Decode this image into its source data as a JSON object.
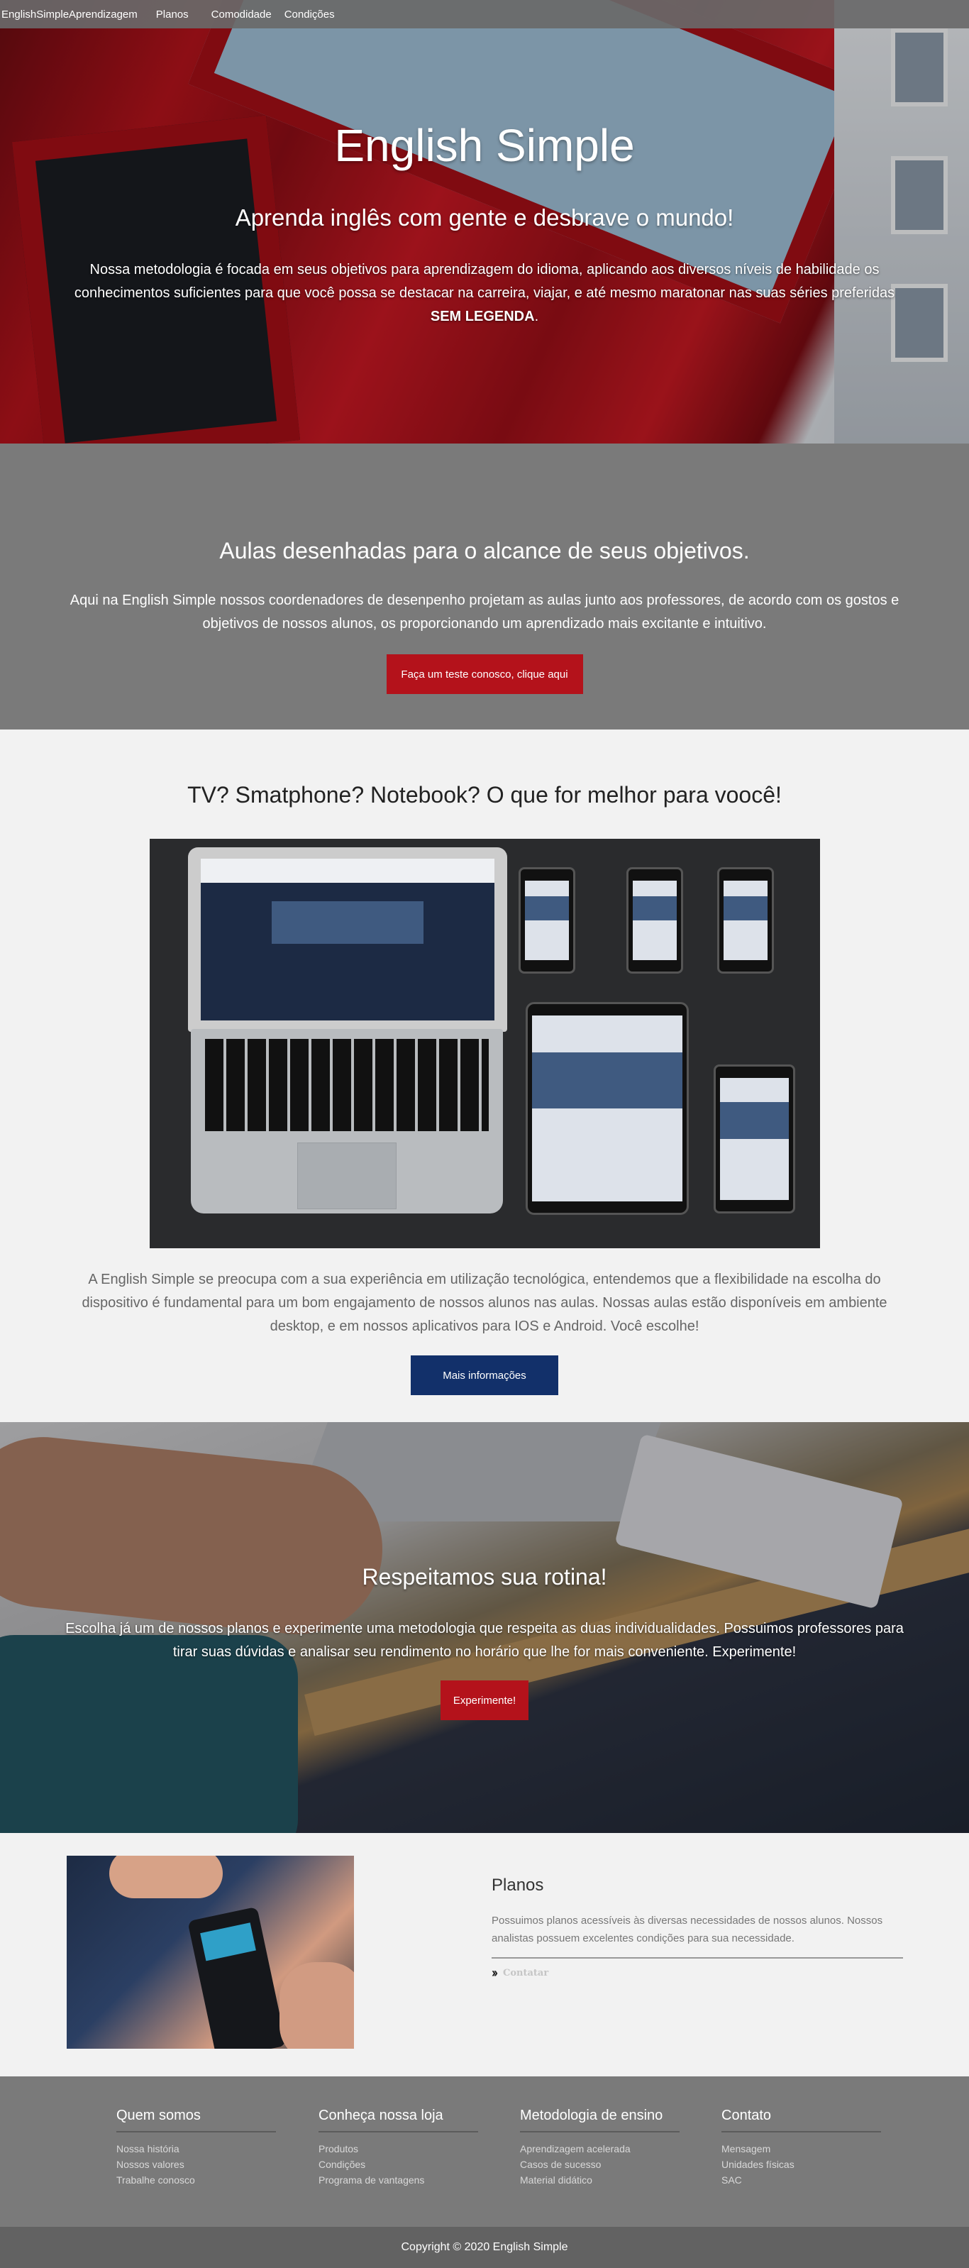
{
  "nav": {
    "brand": "EnglishSimple",
    "links": [
      "Aprendizagem",
      "Planos",
      "Comodidade",
      "Condições"
    ]
  },
  "hero": {
    "title": "English Simple",
    "subtitle": "Aprenda inglês com gente e desbrave o mundo!",
    "text": "Nossa metodologia é focada em seus objetivos para aprendizagem do idioma, aplicando aos diversos níveis de habilidade os conhecimentos suficientes para que você possa se destacar na carreira, viajar, e até mesmo maratonar nas suas séries preferidas",
    "text_strong": "SEM LEGENDA",
    "text_end": "."
  },
  "aulas": {
    "title": "Aulas desenhadas para o alcance de seus objetivos.",
    "text": "Aqui na English Simple nossos coordenadores de desenpenho projetam as aulas junto aos professores, de acordo com os gostos e objetivos de nossos alunos, os proporcionando um aprendizado mais excitante e intuitivo.",
    "button": "Faça um teste conosco, clique aqui"
  },
  "tech": {
    "title": "TV? Smatphone? Notebook? O que for melhor para voocê!",
    "text": "A English Simple se preocupa com a sua experiência em utilização tecnológica, entendemos que a flexibilidade na escolha do dispositivo é fundamental para um bom engajamento de nossos alunos nas aulas. Nossas aulas estão disponíveis em ambiente desktop, e em nossos aplicativos para IOS e Android. Você escolhe!",
    "button": "Mais informações"
  },
  "rotina": {
    "title": "Respeitamos sua rotina!",
    "text": "Escolha já um de nossos planos e experimente uma metodologia que respeita as duas individualidades. Possuimos professores para tirar suas dúvidas e analisar seu rendimento no horário que lhe for mais conveniente. Experimente!",
    "button": "Experimente!"
  },
  "planos": {
    "title": "Planos",
    "text": "Possuimos planos acessíveis às diversas necessidades de nossos alunos. Nossos analistas possuem excelentes condições para sua necessidade.",
    "link": "Contatar"
  },
  "footer": {
    "columns": [
      {
        "title": "Quem somos",
        "items": [
          "Nossa história",
          "Nossos valores",
          "Trabalhe conosco"
        ]
      },
      {
        "title": "Conheça nossa loja",
        "items": [
          "Produtos",
          "Condições",
          "Programa de vantagens"
        ]
      },
      {
        "title": "Metodologia de ensino",
        "items": [
          "Aprendizagem acelerada",
          "Casos de sucesso",
          "Material didático"
        ]
      },
      {
        "title": "Contato",
        "items": [
          "Mensagem",
          "Unidades físicas",
          "SAC"
        ]
      }
    ],
    "copyright": "Copyright © 2020 English Simple"
  },
  "colors": {
    "accent_red": "#b4121b",
    "accent_navy": "#12306a",
    "gray_band": "#7a7a7a",
    "nav_bg": "#696969"
  }
}
